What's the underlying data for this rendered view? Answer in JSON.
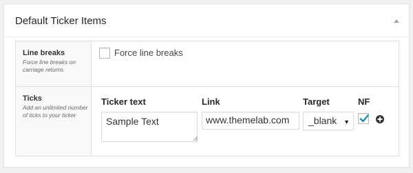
{
  "box": {
    "title": "Default Ticker Items",
    "toggle_icon": "triangle-up-icon"
  },
  "line_breaks": {
    "label": "Line breaks",
    "description": "Force line breaks on carriage returns",
    "checkbox_label": "Force line breaks",
    "checked": false
  },
  "ticks": {
    "label": "Ticks",
    "description": "Add an unlimited number of ticks to your ticker",
    "columns": {
      "ticker_text": "Ticker text",
      "link": "Link",
      "target": "Target",
      "nf": "NF"
    },
    "row": {
      "ticker_text": "Sample Text",
      "link": "www.themelab.com",
      "target": "_blank",
      "nf_checked": true
    },
    "add_icon": "plus-circle-icon"
  },
  "colors": {
    "accent": "#1e8cbe",
    "border": "#dfdfdf",
    "label_bg": "#f9f9f9"
  }
}
